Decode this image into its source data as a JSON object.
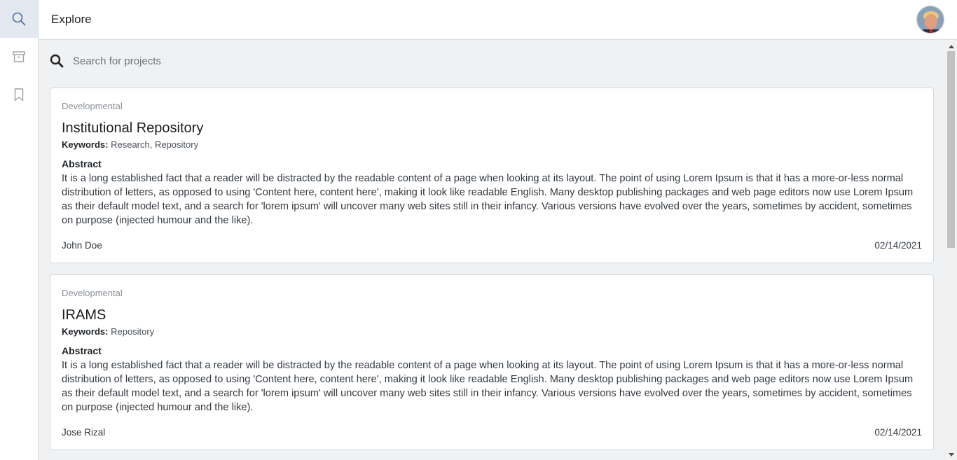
{
  "sidebar": {
    "items": [
      {
        "icon": "search-icon",
        "active": true
      },
      {
        "icon": "archive-icon",
        "active": false
      },
      {
        "icon": "bookmark-icon",
        "active": false
      }
    ]
  },
  "header": {
    "title": "Explore"
  },
  "search": {
    "placeholder": "Search for projects",
    "value": ""
  },
  "projects": [
    {
      "category": "Developmental",
      "title": "Institutional Repository",
      "keywords_label": "Keywords:",
      "keywords": "Research, Repository",
      "abstract_label": "Abstract",
      "abstract": "It is a long established fact that a reader will be distracted by the readable content of a page when looking at its layout. The point of using Lorem Ipsum is that it has a more-or-less normal distribution of letters, as opposed to using 'Content here, content here', making it look like readable English. Many desktop publishing packages and web page editors now use Lorem Ipsum as their default model text, and a search for 'lorem ipsum' will uncover many web sites still in their infancy. Various versions have evolved over the years, sometimes by accident, sometimes on purpose (injected humour and the like).",
      "author": "John Doe",
      "date": "02/14/2021"
    },
    {
      "category": "Developmental",
      "title": "IRAMS",
      "keywords_label": "Keywords:",
      "keywords": "Repository",
      "abstract_label": "Abstract",
      "abstract": "It is a long established fact that a reader will be distracted by the readable content of a page when looking at its layout. The point of using Lorem Ipsum is that it has a more-or-less normal distribution of letters, as opposed to using 'Content here, content here', making it look like readable English. Many desktop publishing packages and web page editors now use Lorem Ipsum as their default model text, and a search for 'lorem ipsum' will uncover many web sites still in their infancy. Various versions have evolved over the years, sometimes by accident, sometimes on purpose (injected humour and the like).",
      "author": "Jose Rizal",
      "date": "02/14/2021"
    }
  ],
  "colors": {
    "sidebar_active": "#e4e8f0",
    "background": "#f0f1f3",
    "card": "#ffffff",
    "icon": "#9aa0a6"
  }
}
